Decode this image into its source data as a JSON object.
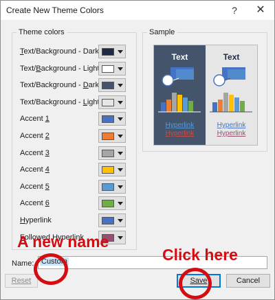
{
  "window": {
    "title": "Create New Theme Colors",
    "help_glyph": "?",
    "close_glyph": "✕"
  },
  "theme_colors": {
    "legend": "Theme colors",
    "rows": [
      {
        "pre": "",
        "ul": "T",
        "post": "ext/Background - Dark 1",
        "color": "#1f2a44"
      },
      {
        "pre": "Text/",
        "ul": "B",
        "post": "ackground - Light 1",
        "color": "#ffffff"
      },
      {
        "pre": "Text/Background - ",
        "ul": "D",
        "post": "ark 2",
        "color": "#44546a"
      },
      {
        "pre": "Text/Background - ",
        "ul": "L",
        "post": "ight 2",
        "color": "#e7e6e6"
      },
      {
        "pre": "Accent ",
        "ul": "1",
        "post": "",
        "color": "#4472c4"
      },
      {
        "pre": "Accent ",
        "ul": "2",
        "post": "",
        "color": "#ed7d31"
      },
      {
        "pre": "Accent ",
        "ul": "3",
        "post": "",
        "color": "#a5a5a5"
      },
      {
        "pre": "Accent ",
        "ul": "4",
        "post": "",
        "color": "#ffc000"
      },
      {
        "pre": "Accent ",
        "ul": "5",
        "post": "",
        "color": "#5b9bd5"
      },
      {
        "pre": "Accent ",
        "ul": "6",
        "post": "",
        "color": "#70ad47"
      },
      {
        "pre": "",
        "ul": "H",
        "post": "yperlink",
        "color": "#4472c4"
      },
      {
        "pre": "",
        "ul": "F",
        "post": "ollowed Hyperlink",
        "color": "#954f72"
      }
    ]
  },
  "sample": {
    "legend": "Sample",
    "text_label": "Text",
    "hyperlink": "Hyperlink",
    "followed_hyperlink": "Hyperlink",
    "dark_text_color": "#ffffff",
    "light_text_color": "#1f2a44",
    "dark_link_color": "#5b9bd5",
    "dark_flink_color": "#c0504d",
    "light_link_color": "#4472c4",
    "light_flink_color": "#954f72"
  },
  "name_field": {
    "label": "Name:",
    "value": "Custom"
  },
  "buttons": {
    "reset": "Reset",
    "save": "Save",
    "cancel": "Cancel"
  },
  "annotations": {
    "new_name": "A new name",
    "click_here": "Click here",
    "color": "#d40d12"
  }
}
